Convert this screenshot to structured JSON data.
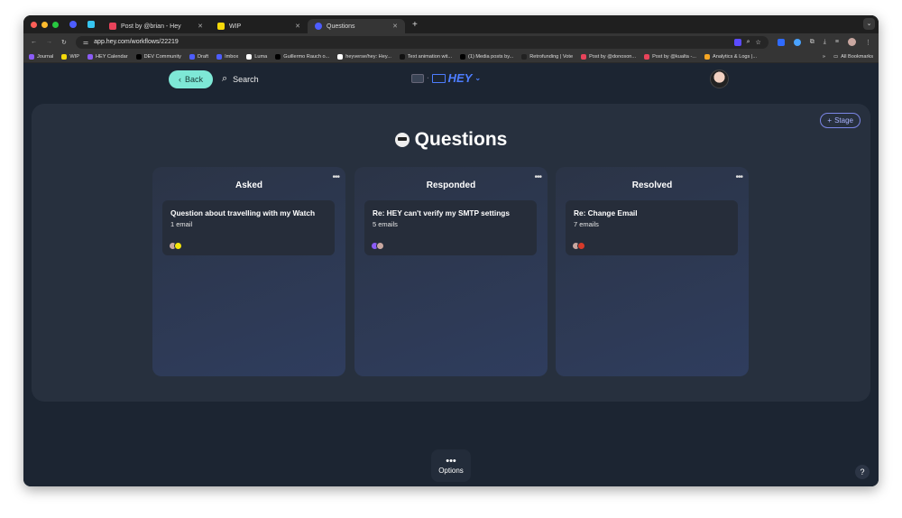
{
  "browser": {
    "tabs": [
      {
        "label": "Post by @brian - Hey",
        "color": "#e8435a"
      },
      {
        "label": "WIP",
        "color": "#f5d90a"
      },
      {
        "label": "Questions",
        "color": "#4d5dff",
        "active": true
      }
    ],
    "url": "app.hey.com/workflows/22219",
    "bookmarks": [
      {
        "label": "Journal",
        "color": "#8b5cf6"
      },
      {
        "label": "WIP",
        "color": "#f5d90a"
      },
      {
        "label": "HEY Calendar",
        "color": "#8b5cf6"
      },
      {
        "label": "DEV Community",
        "color": "#000000"
      },
      {
        "label": "Draft",
        "color": "#4d5dff"
      },
      {
        "label": "Imbox",
        "color": "#4d5dff"
      },
      {
        "label": "Luma",
        "color": "#ffffff"
      },
      {
        "label": "Guillermo Rauch o...",
        "color": "#000000"
      },
      {
        "label": "heyverse/hey: Hey...",
        "color": "#ffffff"
      },
      {
        "label": "Text animation wit...",
        "color": "#111111"
      },
      {
        "label": "(1) Media posts by...",
        "color": "#000000"
      },
      {
        "label": "Retrofunding | Vote",
        "color": "#222222"
      },
      {
        "label": "Post by @donoson...",
        "color": "#e8435a"
      },
      {
        "label": "Post by @kualta -...",
        "color": "#e8435a"
      },
      {
        "label": "Analytics & Logs |...",
        "color": "#f5a623"
      }
    ],
    "all_bookmarks": "All Bookmarks"
  },
  "header": {
    "back_label": "Back",
    "search_label": "Search",
    "logo": "HEY"
  },
  "page": {
    "title": "Questions",
    "stage_label": "Stage"
  },
  "columns": [
    {
      "title": "Asked",
      "card": {
        "title": "Question about travelling with my Watch",
        "count": "1 email",
        "avatars": [
          "#c9a7a0",
          "#f5e50a"
        ]
      }
    },
    {
      "title": "Responded",
      "card": {
        "title": "Re: HEY can't verify my SMTP settings",
        "count": "5 emails",
        "avatars": [
          "#8b5cf6",
          "#c9a7a0"
        ]
      }
    },
    {
      "title": "Resolved",
      "card": {
        "title": "Re: Change Email",
        "count": "7 emails",
        "avatars": [
          "#c9a7a0",
          "#d63a2a"
        ]
      }
    }
  ],
  "footer": {
    "options_label": "Options",
    "help": "?"
  }
}
